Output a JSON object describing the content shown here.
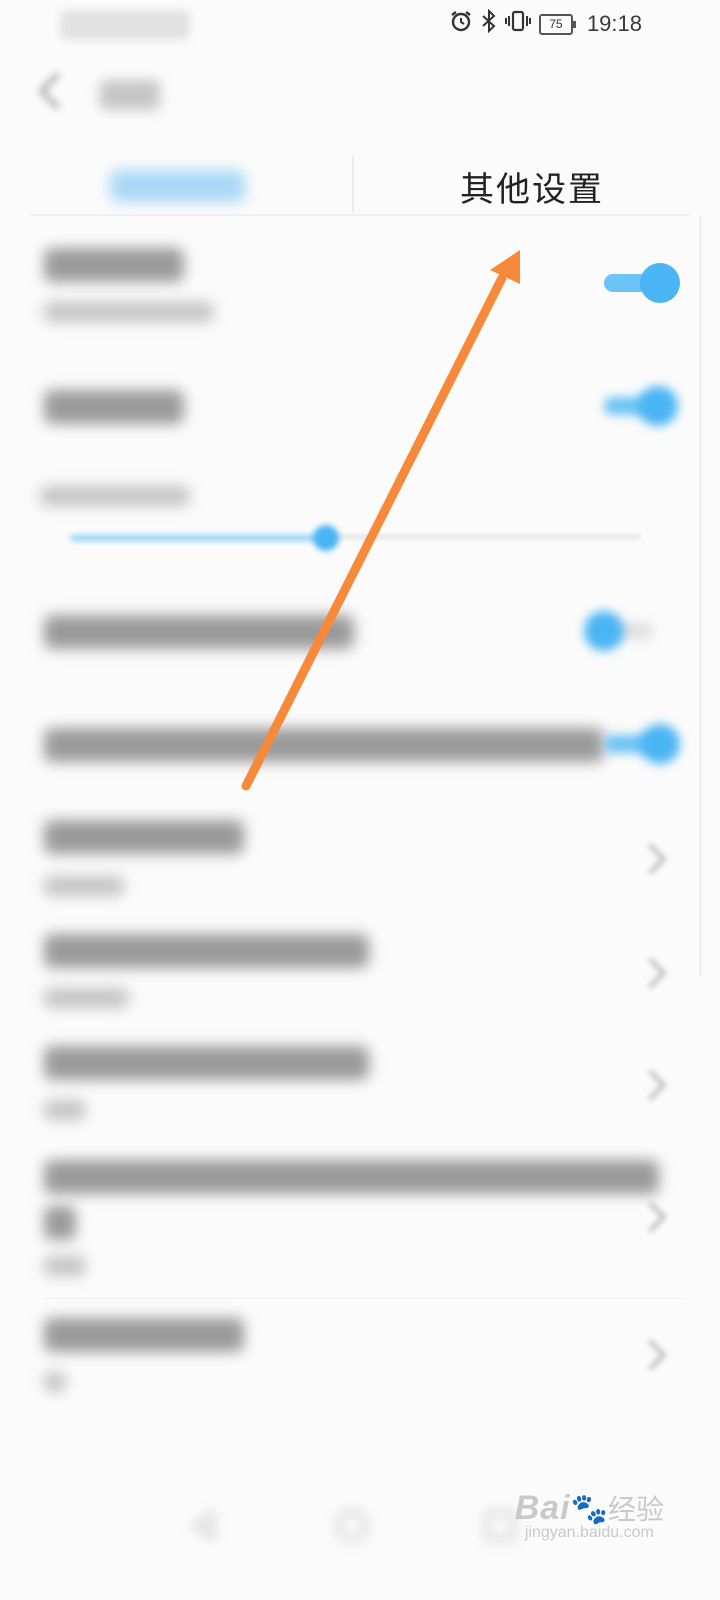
{
  "status_bar": {
    "battery": "75",
    "time": "19:18",
    "icons": [
      "alarm-icon",
      "bluetooth-icon",
      "vibrate-icon",
      "battery-icon"
    ]
  },
  "tabs": {
    "active_label": "其他设置"
  },
  "watermark": {
    "logo": "Bai",
    "logo_suffix": "经验",
    "url": "jingyan.baidu.com"
  },
  "annotation": {
    "arrow_color": "#f7893a"
  },
  "colors": {
    "accent": "#4ab5f4",
    "background": "#fbfbfb"
  }
}
